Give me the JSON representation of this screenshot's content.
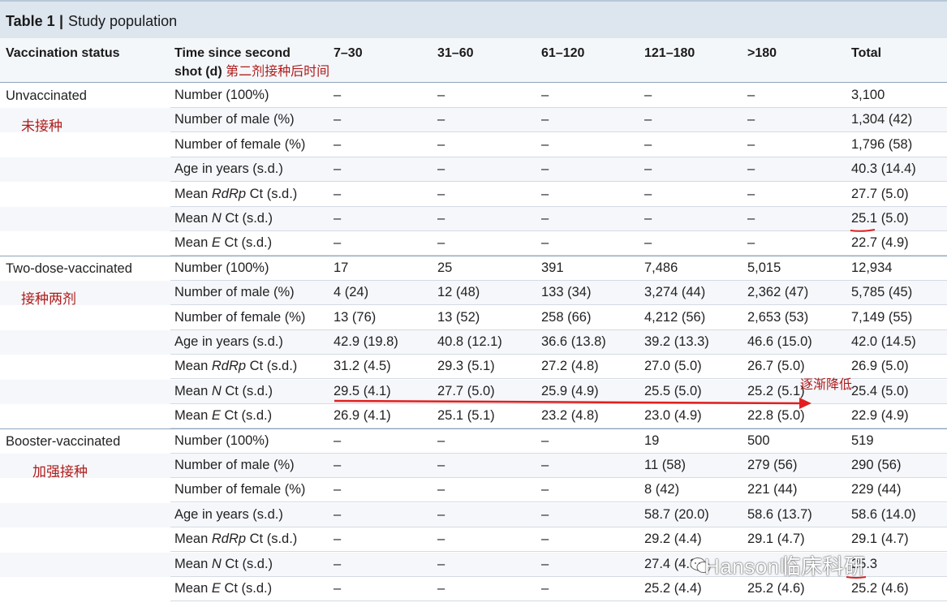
{
  "caption": {
    "number": "Table 1",
    "separator": "|",
    "title": "Study population"
  },
  "header": {
    "col0": "Vaccination status",
    "col1_line1": "Time since second",
    "col1_line2": "shot (d)",
    "col1_cn": "第二剂接种后时间",
    "cols": [
      "7–30",
      "31–60",
      "61–120",
      "121–180",
      ">180",
      "Total"
    ]
  },
  "groups": [
    {
      "label": "Unvaccinated",
      "cn": "未接种",
      "rows": [
        {
          "pre": "Number (100%)",
          "em": "",
          "post": "",
          "vals": [
            "–",
            "–",
            "–",
            "–",
            "–",
            "3,100"
          ]
        },
        {
          "pre": "Number of male (%)",
          "em": "",
          "post": "",
          "vals": [
            "–",
            "–",
            "–",
            "–",
            "–",
            "1,304 (42)"
          ]
        },
        {
          "pre": "Number of female (%)",
          "em": "",
          "post": "",
          "vals": [
            "–",
            "–",
            "–",
            "–",
            "–",
            "1,796 (58)"
          ]
        },
        {
          "pre": "Age in years (s.d.)",
          "em": "",
          "post": "",
          "vals": [
            "–",
            "–",
            "–",
            "–",
            "–",
            "40.3 (14.4)"
          ]
        },
        {
          "pre": "Mean ",
          "em": "RdRp",
          "post": " Ct (s.d.)",
          "vals": [
            "–",
            "–",
            "–",
            "–",
            "–",
            "27.7 (5.0)"
          ]
        },
        {
          "pre": "Mean ",
          "em": "N",
          "post": " Ct (s.d.)",
          "vals": [
            "–",
            "–",
            "–",
            "–",
            "–",
            "25.1 (5.0)"
          ]
        },
        {
          "pre": "Mean ",
          "em": "E",
          "post": " Ct (s.d.)",
          "vals": [
            "–",
            "–",
            "–",
            "–",
            "–",
            "22.7 (4.9)"
          ]
        }
      ]
    },
    {
      "label": "Two-dose-vaccinated",
      "cn": "接种两剂",
      "rows": [
        {
          "pre": "Number (100%)",
          "em": "",
          "post": "",
          "vals": [
            "17",
            "25",
            "391",
            "7,486",
            "5,015",
            "12,934"
          ]
        },
        {
          "pre": "Number of male (%)",
          "em": "",
          "post": "",
          "vals": [
            "4 (24)",
            "12 (48)",
            "133 (34)",
            "3,274 (44)",
            "2,362 (47)",
            "5,785 (45)"
          ]
        },
        {
          "pre": "Number of female (%)",
          "em": "",
          "post": "",
          "vals": [
            "13 (76)",
            "13 (52)",
            "258 (66)",
            "4,212 (56)",
            "2,653 (53)",
            "7,149 (55)"
          ]
        },
        {
          "pre": "Age in years (s.d.)",
          "em": "",
          "post": "",
          "vals": [
            "42.9 (19.8)",
            "40.8 (12.1)",
            "36.6 (13.8)",
            "39.2 (13.3)",
            "46.6 (15.0)",
            "42.0 (14.5)"
          ]
        },
        {
          "pre": "Mean ",
          "em": "RdRp",
          "post": " Ct (s.d.)",
          "vals": [
            "31.2 (4.5)",
            "29.3 (5.1)",
            "27.2 (4.8)",
            "27.0 (5.0)",
            "26.7 (5.0)",
            "26.9 (5.0)"
          ]
        },
        {
          "pre": "Mean ",
          "em": "N",
          "post": " Ct (s.d.)",
          "vals": [
            "29.5 (4.1)",
            "27.7 (5.0)",
            "25.9 (4.9)",
            "25.5 (5.0)",
            "25.2 (5.1)",
            "25.4 (5.0)"
          ]
        },
        {
          "pre": "Mean ",
          "em": "E",
          "post": " Ct (s.d.)",
          "vals": [
            "26.9 (4.1)",
            "25.1 (5.1)",
            "23.2 (4.8)",
            "23.0 (4.9)",
            "22.8 (5.0)",
            "22.9 (4.9)"
          ]
        }
      ]
    },
    {
      "label": "Booster-vaccinated",
      "cn": "加强接种",
      "rows": [
        {
          "pre": "Number (100%)",
          "em": "",
          "post": "",
          "vals": [
            "–",
            "–",
            "–",
            "19",
            "500",
            "519"
          ]
        },
        {
          "pre": "Number of male (%)",
          "em": "",
          "post": "",
          "vals": [
            "–",
            "–",
            "–",
            "11 (58)",
            "279 (56)",
            "290 (56)"
          ]
        },
        {
          "pre": "Number of female (%)",
          "em": "",
          "post": "",
          "vals": [
            "–",
            "–",
            "–",
            "8 (42)",
            "221 (44)",
            "229 (44)"
          ]
        },
        {
          "pre": "Age in years (s.d.)",
          "em": "",
          "post": "",
          "vals": [
            "–",
            "–",
            "–",
            "58.7 (20.0)",
            "58.6 (13.7)",
            "58.6 (14.0)"
          ]
        },
        {
          "pre": "Mean ",
          "em": "RdRp",
          "post": " Ct (s.d.)",
          "vals": [
            "–",
            "–",
            "–",
            "29.2 (4.4)",
            "29.1 (4.7)",
            "29.1 (4.7)"
          ]
        },
        {
          "pre": "Mean ",
          "em": "N",
          "post": " Ct (s.d.)",
          "vals": [
            "–",
            "–",
            "–",
            "27.4 (4.3)",
            "",
            "25.3"
          ]
        },
        {
          "pre": "Mean ",
          "em": "E",
          "post": " Ct (s.d.)",
          "vals": [
            "–",
            "–",
            "–",
            "25.2 (4.4)",
            "25.2 (4.6)",
            "25.2 (4.6)"
          ]
        }
      ]
    }
  ],
  "annotation": {
    "trend_cn": "逐渐降低",
    "color": "#e02020"
  },
  "watermark": {
    "text": "Hanson临床科研",
    "icon": "wechat-icon"
  }
}
